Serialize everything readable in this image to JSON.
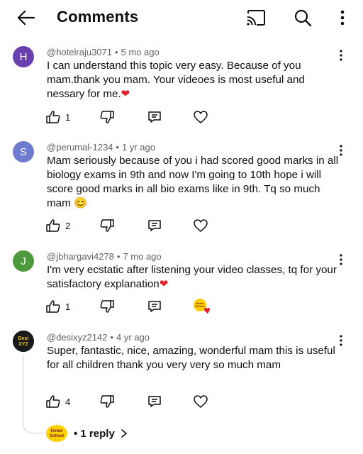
{
  "header": {
    "title": "Comments"
  },
  "comments": [
    {
      "avatar_letter": "H",
      "avatar_color": "#6a3fb0",
      "author": "@hotelraju3071",
      "time": "5 mo ago",
      "text": "I can understand this topic very easy. Because of you mam.thank you mam. Your videoes is most useful and nessary for me.",
      "emoji": "❤",
      "likes": "1"
    },
    {
      "avatar_letter": "S",
      "avatar_color": "#6d7bd0",
      "author": "@perumal-1234",
      "time": "1 yr ago",
      "text": "Mam seriously because of you i had scored good marks in all biology exams in 9th and now I'm going to 10th hope i will score good marks in all bio exams like in 9th. Tq so much mam",
      "emoji": "😊",
      "likes": "2"
    },
    {
      "avatar_letter": "J",
      "avatar_color": "#4d9a3c",
      "author": "@jbhargavi4278",
      "time": "7 mo ago",
      "text": "I'm very ecstatic after listening your video classes, tq for your satisfactory explanation",
      "emoji": "❤",
      "likes": "1",
      "creator_heart": true,
      "creator_avatar_text": "Home School"
    },
    {
      "avatar_text": "Desi XYZ",
      "avatar_color": "#1a1a1a",
      "author": "@desixyz2142",
      "time": "4 yr ago",
      "text": "Super, fantastic, nice, amazing, wonderful mam this is useful for all children thank you very very so much mam",
      "likes": "4",
      "replies_label": "1 reply",
      "reply_avatar_text": "Home School"
    }
  ],
  "colors": {
    "accent_heart": "#e0202a",
    "muted": "#606060"
  }
}
